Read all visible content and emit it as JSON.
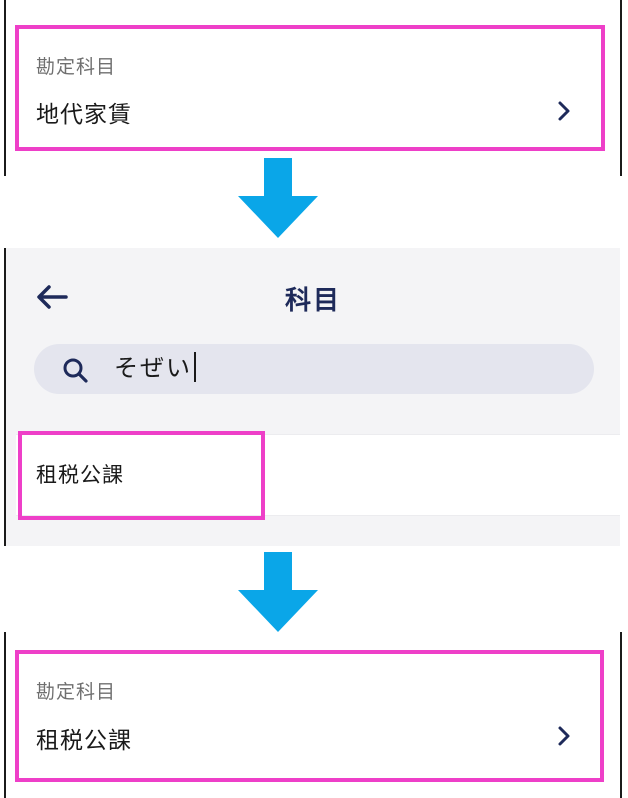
{
  "step1": {
    "caption": "勘定科目",
    "value": "地代家賃"
  },
  "search_screen": {
    "title": "科目",
    "search_query": "そぜい",
    "results": [
      "租税公課"
    ]
  },
  "step3": {
    "caption": "勘定科目",
    "value": "租税公課"
  },
  "colors": {
    "highlight": "#ee3fc8",
    "arrow": "#0aa6e8",
    "navy": "#1e2a5a"
  },
  "icons": {
    "chevron": "chevron-right-icon",
    "back": "arrow-left-icon",
    "search": "search-icon",
    "flow": "arrow-down-icon"
  }
}
